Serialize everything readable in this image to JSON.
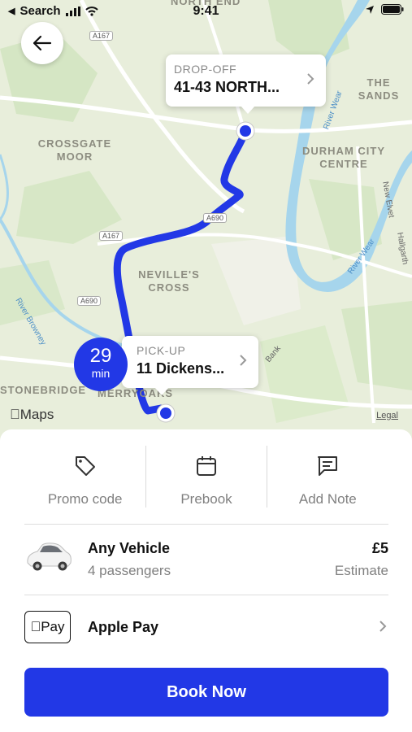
{
  "status_bar": {
    "back_app": "Search",
    "time": "9:41"
  },
  "map": {
    "labels": {
      "north_end": "NORTH END",
      "the_sands": "THE SANDS",
      "crossgate_moor": "CROSSGATE MOOR",
      "durham_city_centre": "DURHAM CITY CENTRE",
      "nevilles_cross": "NEVILLE'S CROSS",
      "stonebridge": "STONEBRIDGE",
      "merryoaks": "MERRYOAKS"
    },
    "roads": {
      "a167_top": "A167",
      "a167_mid": "A167",
      "a690_mid": "A690",
      "a690_left": "A690"
    },
    "rivers": {
      "wear_top": "River Wear",
      "wear_right": "River Wear",
      "browney": "River Browney",
      "new_elvet": "New Elvet",
      "hallgarth": "Hallgarth",
      "bank": "Bank"
    },
    "attribution": "Maps",
    "legal": "Legal",
    "route_color": "#2238e6"
  },
  "dropoff": {
    "caption": "DROP-OFF",
    "address": "41-43 NORTH..."
  },
  "pickup": {
    "caption": "PICK-UP",
    "address": "11 Dickens..."
  },
  "eta": {
    "value": "29",
    "unit": "min"
  },
  "actions": [
    {
      "label": "Promo code",
      "icon": "tag-icon"
    },
    {
      "label": "Prebook",
      "icon": "calendar-icon"
    },
    {
      "label": "Add Note",
      "icon": "note-icon"
    }
  ],
  "vehicle": {
    "name": "Any Vehicle",
    "passengers": "4 passengers",
    "price": "£5",
    "price_note": "Estimate"
  },
  "payment": {
    "badge": "Pay",
    "method": "Apple Pay"
  },
  "book_button": "Book Now",
  "colors": {
    "accent": "#2238e6"
  }
}
